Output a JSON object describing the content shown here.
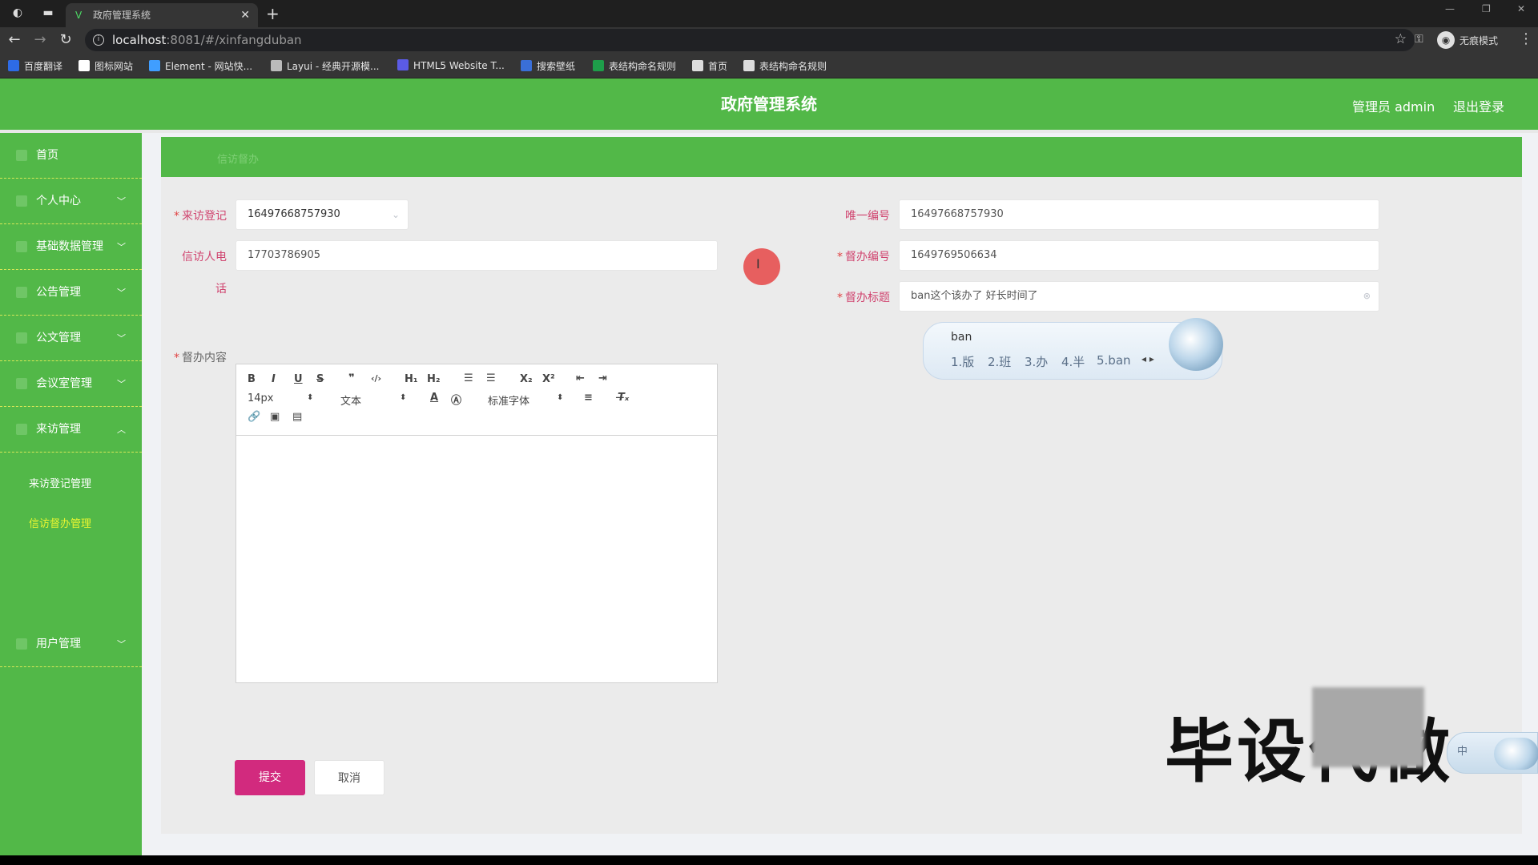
{
  "browser": {
    "tab_title": "政府管理系统",
    "new_tab_symbol": "+",
    "url_host": "localhost",
    "url_rest": ":8081/#/xinfangduban",
    "incognito_label": "无痕模式",
    "bookmarks": [
      {
        "label": "百度翻译",
        "color": "#2e6be6"
      },
      {
        "label": "图标网站",
        "color": "#ffffff"
      },
      {
        "label": "Element - 网站快...",
        "color": "#409eff"
      },
      {
        "label": "Layui - 经典开源模...",
        "color": "#bbbbbb"
      },
      {
        "label": "HTML5 Website T...",
        "color": "#5b5be6"
      },
      {
        "label": "搜索壁纸",
        "color": "#3a6fd8"
      },
      {
        "label": "表结构命名规则",
        "color": "#1e9e4a"
      },
      {
        "label": "首页",
        "color": "#dddddd"
      },
      {
        "label": "表结构命名规则",
        "color": "#dddddd"
      }
    ]
  },
  "header": {
    "title": "政府管理系统",
    "admin": "管理员 admin",
    "logout": "退出登录",
    "color": "#52b848"
  },
  "sidebar": {
    "items": [
      {
        "label": "首页",
        "has_chevron": false
      },
      {
        "label": "个人中心",
        "has_chevron": true
      },
      {
        "label": "基础数据管理",
        "has_chevron": true
      },
      {
        "label": "公告管理",
        "has_chevron": true
      },
      {
        "label": "公文管理",
        "has_chevron": true
      },
      {
        "label": "会议室管理",
        "has_chevron": true
      },
      {
        "label": "来访管理",
        "has_chevron": true,
        "expanded": true
      },
      {
        "label": "用户管理",
        "has_chevron": true
      }
    ],
    "sub_items": [
      {
        "label": "来访登记管理"
      },
      {
        "label": "信访督办管理",
        "active": true
      }
    ]
  },
  "breadcrumb": "信访督办",
  "form": {
    "visit_register": {
      "label": "来访登记",
      "value": "16497668757930",
      "required": true
    },
    "unique_no": {
      "label": "唯一编号",
      "value": "16497668757930"
    },
    "petitioner_phone": {
      "label_line1": "信访人电",
      "label_line2": "话",
      "value": "17703786905"
    },
    "supervise_no": {
      "label": "督办编号",
      "value": "1649769506634",
      "required": true
    },
    "supervise_title": {
      "label": "督办标题",
      "value": "ban这个该办了 好长时间了",
      "required": true
    },
    "supervise_content": {
      "label": "督办内容",
      "required": true
    }
  },
  "editor": {
    "font_size": "14px",
    "text_type": "文本",
    "font_family": "标准字体",
    "buttons": [
      "B",
      "I",
      "U",
      "S",
      "❞",
      "</>",
      "H1",
      "H2",
      "≡",
      "≣",
      "X₂",
      "X²",
      "⇤",
      "⇥"
    ]
  },
  "actions": {
    "submit": "提交",
    "cancel": "取消",
    "submit_color": "#d22a7e"
  },
  "ime": {
    "input": "ban",
    "candidates": [
      "1.版",
      "2.班",
      "3.办",
      "4.半",
      "5.ban"
    ],
    "status": "中"
  },
  "watermark": "毕设代做"
}
